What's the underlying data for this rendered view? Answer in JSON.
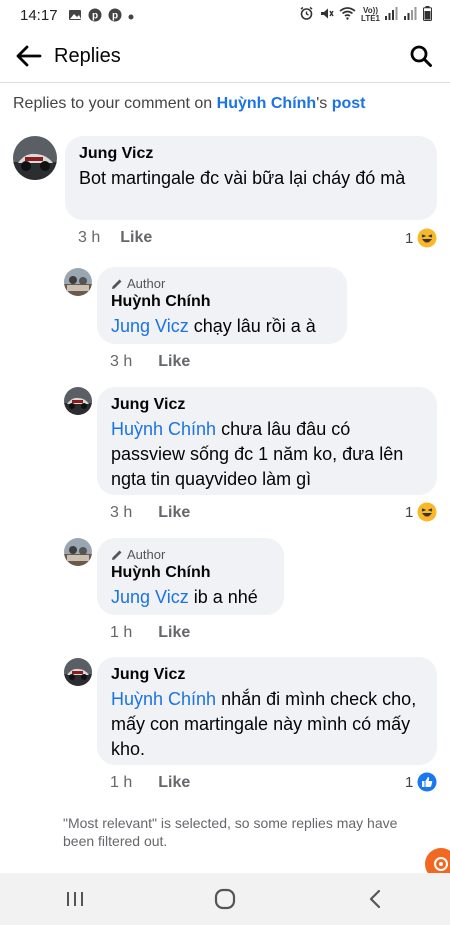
{
  "status_bar": {
    "time": "14:17",
    "network_label_top": "Vo))",
    "network_label_bottom": "LTE1"
  },
  "header": {
    "title": "Replies"
  },
  "context": {
    "prefix": "Replies to your comment on ",
    "name": "Huỳnh Chính",
    "possessive": "'s ",
    "post": "post"
  },
  "comments": [
    {
      "name": "Jung Vicz",
      "text": "Bot martingale đc vài bữa lại cháy đó mà",
      "time": "3 h",
      "like": "Like",
      "reaction_count": "1",
      "reaction_icon": "haha-icon"
    },
    {
      "badge": "Author",
      "name": "Huỳnh Chính",
      "mention": "Jung Vicz",
      "text": " chạy lâu rồi a à",
      "time": "3 h",
      "like": "Like"
    },
    {
      "name": "Jung Vicz",
      "mention": "Huỳnh Chính",
      "text": " chưa lâu đâu có passview sống đc 1 năm ko, đưa lên ngta tin quayvideo làm gì",
      "time": "3 h",
      "like": "Like",
      "reaction_count": "1",
      "reaction_icon": "haha-icon"
    },
    {
      "badge": "Author",
      "name": "Huỳnh Chính",
      "mention": "Jung Vicz",
      "text": " ib a nhé",
      "time": "1 h",
      "like": "Like"
    },
    {
      "name": "Jung Vicz",
      "mention": "Huỳnh Chính",
      "text": " nhắn đi mình check cho, mấy con martingale này mình có mấy kho.",
      "time": "1 h",
      "like": "Like",
      "reaction_count": "1",
      "reaction_icon": "like-icon"
    }
  ],
  "footer_note": "\"Most relevant\" is selected, so some replies may have been filtered out.",
  "colors": {
    "link": "#1b74e4",
    "bubble": "#f0f2f5",
    "meta": "#65676b",
    "haha": "#f7b928",
    "like": "#1877f2"
  }
}
